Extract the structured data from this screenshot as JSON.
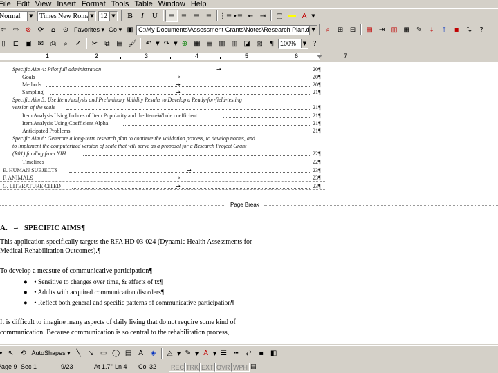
{
  "menubar": {
    "items": [
      "File",
      "Edit",
      "View",
      "Insert",
      "Format",
      "Tools",
      "Table",
      "Window",
      "Help"
    ]
  },
  "format_toolbar": {
    "style_value": "Normal",
    "font_value": "Times New Roman",
    "size_value": "12"
  },
  "web_toolbar": {
    "favorites_label": "Favorites",
    "go_label": "Go",
    "address_value": "C:\\My Documents\\Assessment Grants\\Notes\\Research Plan.doc"
  },
  "standard_toolbar": {
    "zoom_value": "100%"
  },
  "ruler": {
    "numbers": [
      "1",
      "2",
      "3",
      "4",
      "5",
      "6",
      "7"
    ]
  },
  "toc": {
    "entries": [
      {
        "text": "Specific Aim 4: Pilot full administration",
        "page": "20¶"
      },
      {
        "text": "Goals",
        "page": "20¶"
      },
      {
        "text": "Methods",
        "page": "20¶"
      },
      {
        "text": "Sampling",
        "page": "21¶"
      },
      {
        "text": "Specific Aim 5: Use Item Analysis and Preliminary Validity Results to Develop a Ready-for-field-testing",
        "page": ""
      },
      {
        "text": "version of the scale",
        "page": "21¶"
      },
      {
        "text": "Item Analysis Using Indices of Item Popularity and the Item-Whole coefficient",
        "page": "21¶"
      },
      {
        "text": "Item Analysis Using Coefficient Alpha",
        "page": "21¶"
      },
      {
        "text": "Anticipated Problems",
        "page": "21¶"
      },
      {
        "text": "Specific Aim 6: Generate a long-term research plan to continue the validation process, to develop norms, and",
        "page": ""
      },
      {
        "text": "to implement the computerized version of scale that will serve as a proposal for a Research Project Grant",
        "page": ""
      },
      {
        "text": "(R01) funding from NIH",
        "page": "22¶"
      },
      {
        "text": "Timelines",
        "page": "22¶"
      },
      {
        "text": "E. HUMAN SUBJECTS",
        "page": "23¶"
      },
      {
        "text": "F. ANIMALS",
        "page": "23¶"
      },
      {
        "text": "G. LITERATURE CITED",
        "page": "23¶"
      }
    ]
  },
  "page_break_label": "Page Break",
  "section": {
    "heading_letter": "A.",
    "heading_text": "SPECIFIC AIMS¶",
    "para1_line1": "This application specifically targets the RFA HD 03-024 (Dynamic Health Assessments for",
    "para1_line2": "Medical Rehabilitation Outcomes).¶",
    "para2": "To develop a measure of communicative participation¶",
    "bullets": [
      "Sensitive to changes over time, & effects of tx¶",
      "Adults with acquired communication disorders¶",
      "Reflect both general and specific patterns of communicative participation¶"
    ],
    "para3_line1": "It is difficult to imagine many aspects of daily living that do not require some kind of",
    "para3_line2": "communication. Because communication is so central to the rehabilitation process,"
  },
  "draw_toolbar": {
    "autoshapes_label": "AutoShapes"
  },
  "statusbar": {
    "page": "Page 9",
    "section": "Sec 1",
    "page_of": "9/23",
    "at": "At 1.7\"",
    "line": "Ln 4",
    "col": "Col 32",
    "rec": "REC",
    "trk": "TRK",
    "ext": "EXT",
    "ovr": "OVR",
    "wph": "WPH"
  }
}
